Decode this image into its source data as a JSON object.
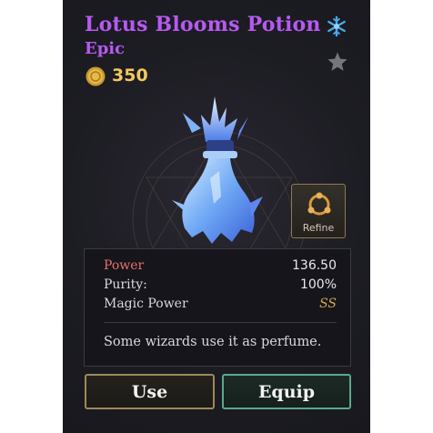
{
  "item": {
    "name": "Lotus Blooms Potion",
    "rarity": "Epic",
    "price": "350",
    "description": "Some wizards use it as perfume.",
    "rarity_color": "#b65af0",
    "icons": [
      "gold-coin-icon",
      "frost-element-icon",
      "favorite-star-icon",
      "potion-image",
      "refine-icon"
    ]
  },
  "refine": {
    "label": "Refine"
  },
  "stats": [
    {
      "label": "Power",
      "value": "136.50"
    },
    {
      "label": "Purity:",
      "value": "100%"
    },
    {
      "label": "Magic Power",
      "value": "SS"
    }
  ],
  "actions": {
    "use_label": "Use",
    "equip_label": "Equip"
  },
  "colors": {
    "price": "#f1c95c",
    "power_label": "#e8706b",
    "grade": "#d1a74b",
    "use_border": "#9c8a57",
    "equip_border": "#5aa88d",
    "panel_bg": "#1b1b22"
  }
}
